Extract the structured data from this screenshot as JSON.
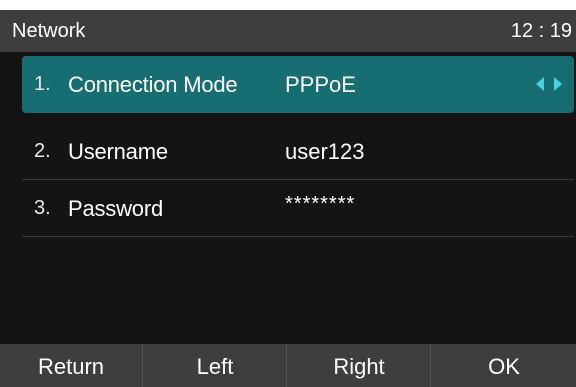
{
  "status_bar": {
    "title": "Network",
    "time": "12 : 19"
  },
  "menu": {
    "items": [
      {
        "index": "1.",
        "label": "Connection Mode",
        "value": "PPPoE",
        "selected": true
      },
      {
        "index": "2.",
        "label": "Username",
        "value": "user123",
        "selected": false
      },
      {
        "index": "3.",
        "label": "Password",
        "value": "********",
        "selected": false
      }
    ],
    "selected_icon": "left-right-arrows-icon"
  },
  "softkeys": {
    "return": "Return",
    "left": "Left",
    "right": "Right",
    "ok": "OK"
  },
  "colors": {
    "background": "#141414",
    "bar": "#3e3e3e",
    "selected_row": "#166e72",
    "arrow_accent": "#46d0e6",
    "text": "#ffffff"
  }
}
